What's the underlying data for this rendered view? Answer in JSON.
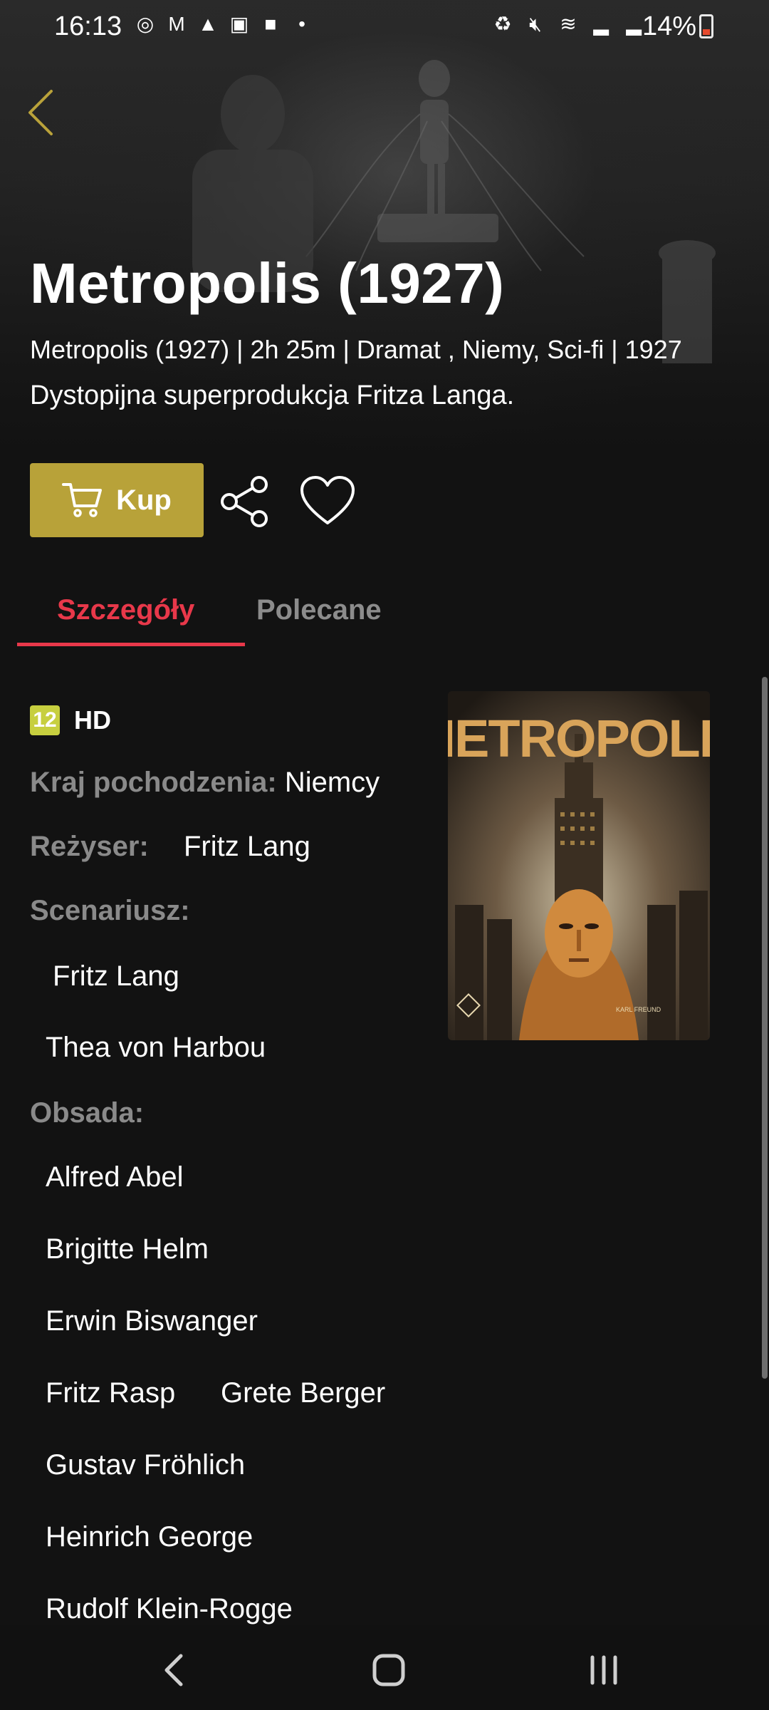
{
  "status_bar": {
    "time": "16:13",
    "battery": "14%"
  },
  "movie": {
    "title": "Metropolis (1927)",
    "meta": "Metropolis (1927) | 2h 25m | Dramat , Niemy, Sci-fi | 1927",
    "description": "Dystopijna superprodukcja Fritza Langa."
  },
  "actions": {
    "buy_label": "Kup"
  },
  "tabs": [
    {
      "label": "Szczegóły",
      "active": true
    },
    {
      "label": "Polecane",
      "active": false
    }
  ],
  "details": {
    "age_rating": "12",
    "quality": "HD",
    "country_label": "Kraj pochodzenia:",
    "country_value": "Niemcy",
    "director_label": "Reżyser:",
    "director_value": "Fritz Lang",
    "writers_label": "Scenariusz:",
    "writers": [
      "Fritz Lang",
      "Thea von Harbou"
    ],
    "cast_label": "Obsada:",
    "cast": [
      "Alfred Abel",
      "Brigitte Helm",
      "Erwin Biswanger",
      "Fritz Rasp",
      "Grete Berger",
      "Gustav Fröhlich",
      "Heinrich George",
      "Rudolf Klein-Rogge"
    ]
  },
  "poster": {
    "title_text": "METROPOLIS",
    "credit_text": "KARL FREUND"
  },
  "colors": {
    "accent_red": "#e8384a",
    "buy_gold": "#b8a239",
    "back_gold": "#b9a23a",
    "age_badge": "#c7cf3f"
  }
}
